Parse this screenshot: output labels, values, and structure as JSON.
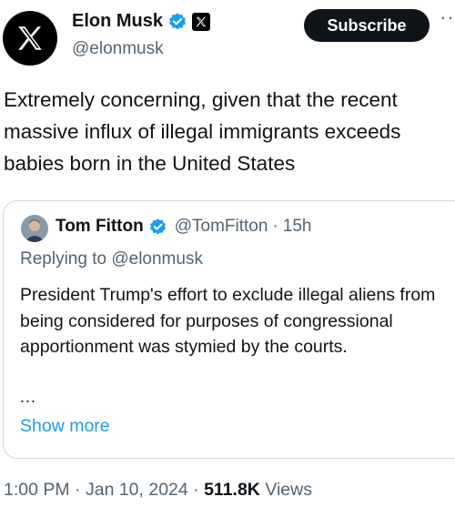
{
  "author": {
    "display_name": "Elon Musk",
    "handle": "@elonmusk",
    "verified_icon": "verified-badge-icon",
    "affiliation_icon": "x-logo-icon"
  },
  "actions": {
    "subscribe_label": "Subscribe",
    "more_label": "···"
  },
  "tweet": {
    "text": "Extremely concerning, given that the recent massive influx of illegal immigrants exceeds babies born in the United States"
  },
  "quoted_tweet": {
    "display_name": "Tom Fitton",
    "handle": "@TomFitton",
    "separator": "·",
    "time_ago": "15h",
    "replying_prefix": "Replying to",
    "replying_to": "@elonmusk",
    "text": "President Trump's effort to exclude illegal aliens from being considered for purposes of congressional apportionment was stymied by the courts.",
    "ellipsis": "...",
    "show_more_label": "Show more"
  },
  "meta": {
    "time": "1:00 PM",
    "sep1": "·",
    "date": "Jan 10, 2024",
    "sep2": "·",
    "views_count": "511.8K",
    "views_label": "Views"
  },
  "colors": {
    "primary_text": "#0f1419",
    "secondary_text": "#536471",
    "link": "#1d9bf0",
    "verified": "#1d9bf0",
    "border": "#cfd9de"
  }
}
